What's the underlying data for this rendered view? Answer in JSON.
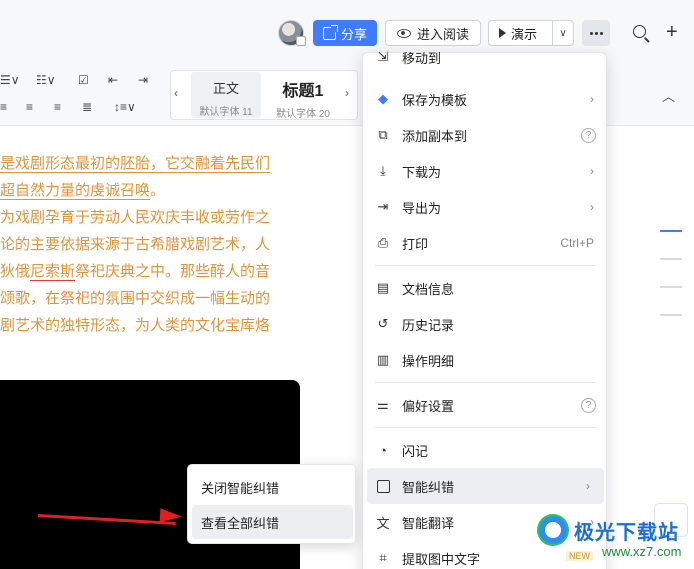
{
  "header": {
    "share_label": "分享",
    "read_label": "进入阅读",
    "present_label": "演示",
    "present_dropdown": "∨",
    "more_icon": "more-dots-icon",
    "plus": "+"
  },
  "style_panel": {
    "normal": {
      "title": "正文",
      "sub": "默认字体 11"
    },
    "heading1": {
      "title": "标题1",
      "sub": "默认字体 20"
    }
  },
  "document": {
    "lines": [
      {
        "pre": "",
        "u": "是戏剧形态最初的胚胎，它交融着先民们",
        "post": ""
      },
      {
        "pre": "",
        "u": "超自然力量的虔诚召唤",
        "post": "。"
      },
      {
        "pre": "为戏剧孕育于劳动人民欢庆丰收或劳作之",
        "u": "",
        "post": ""
      },
      {
        "pre": "论的主要依据来源于古希腊戏剧艺术，人",
        "u": "",
        "post": ""
      },
      {
        "pre": "狄俄",
        "w": "尼索斯",
        "post": "祭祀庆典之中。那些醉人的音"
      },
      {
        "pre": "颂歌，在祭祀的氛围中交织成一幅生动的",
        "u": "",
        "post": ""
      },
      {
        "pre": "剧艺术的独特形态，为人类的文化宝库烙",
        "u": "",
        "post": ""
      }
    ]
  },
  "menu": {
    "move_to": "移动到",
    "save_template": "保存为模板",
    "add_copy": "添加副本到",
    "download_as": "下载为",
    "export_as": "导出为",
    "print": "打印",
    "print_shortcut": "Ctrl+P",
    "doc_info": "文档信息",
    "history": "历史记录",
    "operation_details": "操作明细",
    "preferences": "偏好设置",
    "flash_note": "闪记",
    "smart_proofread": "智能纠错",
    "smart_translate": "智能翻译",
    "extract_text": "提取图中文字",
    "new_badge": "NEW",
    "arrow": "›",
    "help": "?"
  },
  "submenu": {
    "close_proofread": "关闭智能纠错",
    "view_all": "查看全部纠错"
  },
  "watermark": {
    "title": "极光下载站",
    "url": "www.xz7.com"
  },
  "colors": {
    "accent": "#3f7cff",
    "doc_text": "#e0953a",
    "arrow": "#e02020"
  }
}
